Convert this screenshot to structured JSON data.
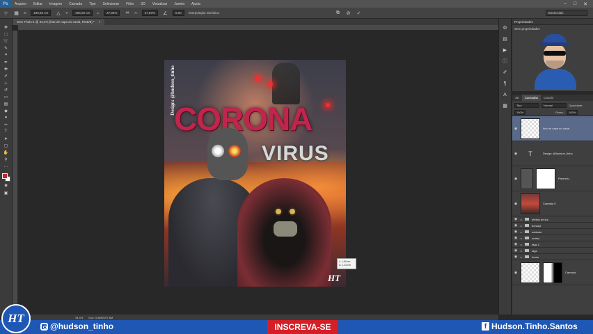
{
  "app": {
    "logo": "Ps"
  },
  "menu": [
    "Arquivo",
    "Editar",
    "Imagem",
    "Camada",
    "Tipo",
    "Selecionar",
    "Filtro",
    "3D",
    "Visualizar",
    "Janela",
    "Ajuda"
  ],
  "window_controls": [
    "–",
    "□",
    "✕"
  ],
  "options": {
    "x_label": "X:",
    "x_value": "190,50 cm",
    "y_label": "Y:",
    "y_value": "306,00 cm",
    "w_label": "L:",
    "w_value": "37,93%",
    "h_label": "A:",
    "h_value": "37,93%",
    "angle_value": "0,00",
    "interp_label": "Interpolação: Bicúbica",
    "workspace": "Essenciais"
  },
  "document_tab": {
    "title": "Sem Título-1 @ 34,4% (fote de capa do canal, RGB/8) *",
    "close": "×"
  },
  "artwork": {
    "title": "CORONA",
    "subtitle": "VIRUS",
    "credit": "Design: @hudson_tinho",
    "logo": "HT"
  },
  "measure_tooltip": {
    "line1": "L: 1,90 cm",
    "line2": "A: 1,23 cm"
  },
  "properties": {
    "header": "Propriedades",
    "label": "Sem propriedades"
  },
  "layers": {
    "tabs": [
      "3D",
      "Camadas",
      "Canais"
    ],
    "filter_label": "Tipo",
    "opacity_label": "Opacidade:",
    "opacity_value": "100%",
    "fill_label": "Preen.:",
    "fill_value": "100%",
    "blend_mode": "Normal",
    "items": [
      {
        "name": "foto de capa do canal",
        "kind": "transparent",
        "selected": true
      },
      {
        "name": "Design: @hudson_tinho",
        "kind": "text"
      },
      {
        "name": "Preench...",
        "kind": "white"
      },
      {
        "name": "Camada 5",
        "kind": "art"
      },
      {
        "name": "efeitos de luz",
        "kind": "folder"
      },
      {
        "name": "fumaça",
        "kind": "folder"
      },
      {
        "name": "soldado",
        "kind": "folder"
      },
      {
        "name": "ombro",
        "kind": "folder"
      },
      {
        "name": "tags 2",
        "kind": "folder"
      },
      {
        "name": "tags",
        "kind": "folder"
      },
      {
        "name": "fundo",
        "kind": "folder"
      },
      {
        "name": "Camada",
        "kind": "mask"
      }
    ]
  },
  "status": {
    "zoom": "34,4%",
    "doc": "Doc: 4,38M/197,8M"
  },
  "banner": {
    "instagram": "@hudson_tinho",
    "subscribe": "INSCREVA-SE",
    "facebook": "Hudson.Tinho.Santos",
    "logo": "HT"
  },
  "colors": {
    "foreground": "#c0282a",
    "background": "#ffffff",
    "banner": "#1f57b5",
    "subscribe": "#d51f26"
  }
}
